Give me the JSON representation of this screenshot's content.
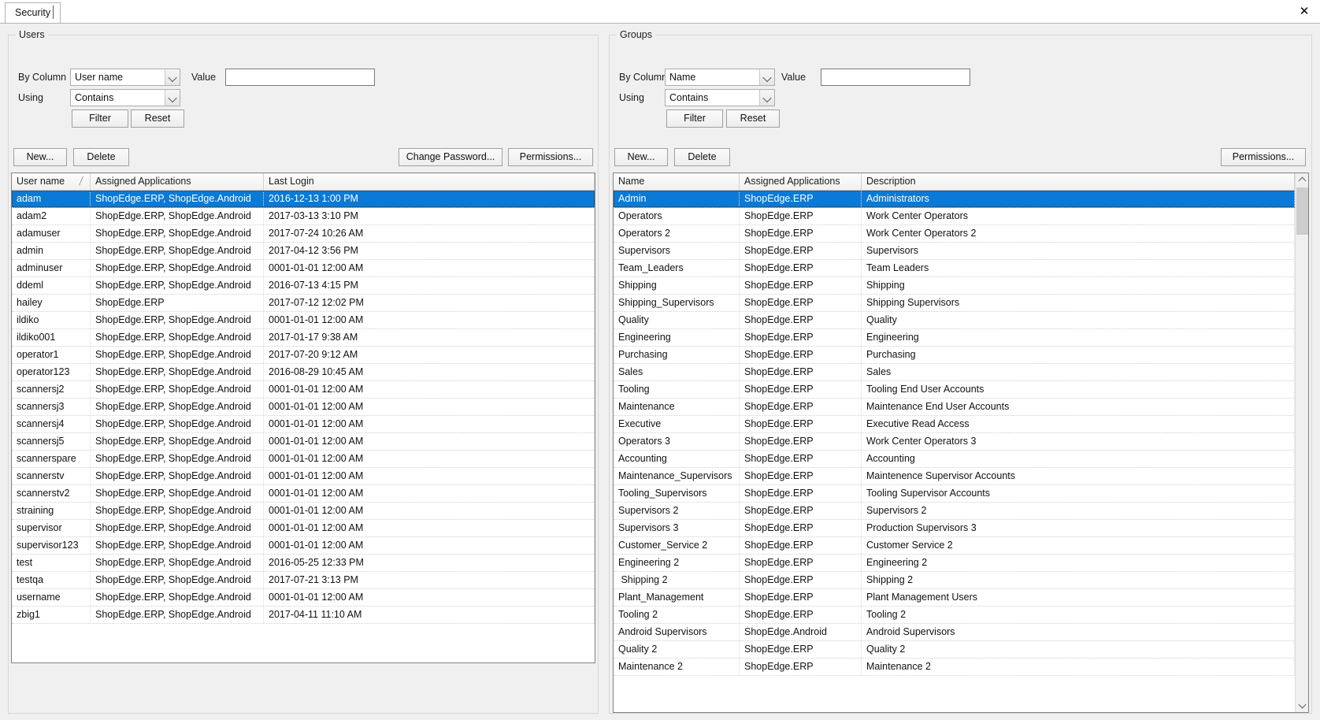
{
  "window": {
    "tab_label": "Security",
    "close_icon": "close-icon"
  },
  "users_panel": {
    "title": "Users",
    "filter": {
      "by_column_label": "By Column",
      "by_column_value": "User name",
      "using_label": "Using",
      "using_value": "Contains",
      "value_label": "Value",
      "value_text": "",
      "value_placeholder": "",
      "filter_button": "Filter",
      "reset_button": "Reset"
    },
    "toolbar": {
      "new_button": "New...",
      "delete_button": "Delete",
      "change_password_button": "Change Password...",
      "permissions_button": "Permissions..."
    },
    "columns": [
      "User name",
      "Assigned Applications",
      "Last Login"
    ],
    "sort_column": "User name",
    "sort_direction": "ascending",
    "selected_row_index": 0,
    "rows": [
      [
        "adam",
        "ShopEdge.ERP, ShopEdge.Android",
        "2016-12-13 1:00 PM"
      ],
      [
        "adam2",
        "ShopEdge.ERP, ShopEdge.Android",
        "2017-03-13 3:10 PM"
      ],
      [
        "adamuser",
        "ShopEdge.ERP, ShopEdge.Android",
        "2017-07-24 10:26 AM"
      ],
      [
        "admin",
        "ShopEdge.ERP, ShopEdge.Android",
        "2017-04-12 3:56 PM"
      ],
      [
        "adminuser",
        "ShopEdge.ERP, ShopEdge.Android",
        "0001-01-01 12:00 AM"
      ],
      [
        "ddeml",
        "ShopEdge.ERP, ShopEdge.Android",
        "2016-07-13 4:15 PM"
      ],
      [
        "hailey",
        "ShopEdge.ERP",
        "2017-07-12 12:02 PM"
      ],
      [
        "ildiko",
        "ShopEdge.ERP, ShopEdge.Android",
        "0001-01-01 12:00 AM"
      ],
      [
        "ildiko001",
        "ShopEdge.ERP, ShopEdge.Android",
        "2017-01-17 9:38 AM"
      ],
      [
        "operator1",
        "ShopEdge.ERP, ShopEdge.Android",
        "2017-07-20 9:12 AM"
      ],
      [
        "operator123",
        "ShopEdge.ERP, ShopEdge.Android",
        "2016-08-29 10:45 AM"
      ],
      [
        "scannersj2",
        "ShopEdge.ERP, ShopEdge.Android",
        "0001-01-01 12:00 AM"
      ],
      [
        "scannersj3",
        "ShopEdge.ERP, ShopEdge.Android",
        "0001-01-01 12:00 AM"
      ],
      [
        "scannersj4",
        "ShopEdge.ERP, ShopEdge.Android",
        "0001-01-01 12:00 AM"
      ],
      [
        "scannersj5",
        "ShopEdge.ERP, ShopEdge.Android",
        "0001-01-01 12:00 AM"
      ],
      [
        "scannerspare",
        "ShopEdge.ERP, ShopEdge.Android",
        "0001-01-01 12:00 AM"
      ],
      [
        "scannerstv",
        "ShopEdge.ERP, ShopEdge.Android",
        "0001-01-01 12:00 AM"
      ],
      [
        "scannerstv2",
        "ShopEdge.ERP, ShopEdge.Android",
        "0001-01-01 12:00 AM"
      ],
      [
        "straining",
        "ShopEdge.ERP, ShopEdge.Android",
        "0001-01-01 12:00 AM"
      ],
      [
        "supervisor",
        "ShopEdge.ERP, ShopEdge.Android",
        "0001-01-01 12:00 AM"
      ],
      [
        "supervisor123",
        "ShopEdge.ERP, ShopEdge.Android",
        "0001-01-01 12:00 AM"
      ],
      [
        "test",
        "ShopEdge.ERP, ShopEdge.Android",
        "2016-05-25 12:33 PM"
      ],
      [
        "testqa",
        "ShopEdge.ERP, ShopEdge.Android",
        "2017-07-21 3:13 PM"
      ],
      [
        "username",
        "ShopEdge.ERP, ShopEdge.Android",
        "0001-01-01 12:00 AM"
      ],
      [
        "zbig1",
        "ShopEdge.ERP, ShopEdge.Android",
        "2017-04-11 11:10 AM"
      ]
    ]
  },
  "groups_panel": {
    "title": "Groups",
    "filter": {
      "by_column_label": "By Column",
      "by_column_value": "Name",
      "using_label": "Using",
      "using_value": "Contains",
      "value_label": "Value",
      "value_text": "",
      "value_placeholder": "",
      "filter_button": "Filter",
      "reset_button": "Reset"
    },
    "toolbar": {
      "new_button": "New...",
      "delete_button": "Delete",
      "permissions_button": "Permissions..."
    },
    "columns": [
      "Name",
      "Assigned Applications",
      "Description"
    ],
    "selected_row_index": 0,
    "rows": [
      [
        "Admin",
        "ShopEdge.ERP",
        "Administrators"
      ],
      [
        "Operators",
        "ShopEdge.ERP",
        "Work Center Operators"
      ],
      [
        "Operators 2",
        "ShopEdge.ERP",
        "Work Center Operators 2"
      ],
      [
        "Supervisors",
        "ShopEdge.ERP",
        "Supervisors"
      ],
      [
        "Team_Leaders",
        "ShopEdge.ERP",
        "Team Leaders"
      ],
      [
        "Shipping",
        "ShopEdge.ERP",
        "Shipping"
      ],
      [
        "Shipping_Supervisors",
        "ShopEdge.ERP",
        "Shipping Supervisors"
      ],
      [
        "Quality",
        "ShopEdge.ERP",
        "Quality"
      ],
      [
        "Engineering",
        "ShopEdge.ERP",
        "Engineering"
      ],
      [
        "Purchasing",
        "ShopEdge.ERP",
        "Purchasing"
      ],
      [
        "Sales",
        "ShopEdge.ERP",
        "Sales"
      ],
      [
        "Tooling",
        "ShopEdge.ERP",
        "Tooling End User Accounts"
      ],
      [
        "Maintenance",
        "ShopEdge.ERP",
        "Maintenance End User Accounts"
      ],
      [
        "Executive",
        "ShopEdge.ERP",
        "Executive Read Access"
      ],
      [
        "Operators 3",
        "ShopEdge.ERP",
        "Work Center Operators 3"
      ],
      [
        "Accounting",
        "ShopEdge.ERP",
        "Accounting"
      ],
      [
        "Maintenance_Supervisors",
        "ShopEdge.ERP",
        "Maintenence Supervisor Accounts"
      ],
      [
        "Tooling_Supervisors",
        "ShopEdge.ERP",
        "Tooling Supervisor Accounts"
      ],
      [
        "Supervisors 2",
        "ShopEdge.ERP",
        "Supervisors 2"
      ],
      [
        "Supervisors 3",
        "ShopEdge.ERP",
        "Production Supervisors 3"
      ],
      [
        "Customer_Service 2",
        "ShopEdge.ERP",
        "Customer Service 2"
      ],
      [
        "Engineering 2",
        "ShopEdge.ERP",
        "Engineering 2"
      ],
      [
        " Shipping 2",
        "ShopEdge.ERP",
        "Shipping 2"
      ],
      [
        "Plant_Management",
        "ShopEdge.ERP",
        "Plant Management Users"
      ],
      [
        "Tooling 2",
        "ShopEdge.ERP",
        "Tooling 2"
      ],
      [
        "Android Supervisors",
        "ShopEdge.Android",
        "Android Supervisors"
      ],
      [
        "Quality 2",
        "ShopEdge.ERP",
        "Quality 2"
      ],
      [
        "Maintenance 2",
        "ShopEdge.ERP",
        "Maintenance 2"
      ]
    ],
    "scrollbar": {
      "up_icon": "chevron-up-icon",
      "down_icon": "chevron-down-icon"
    }
  },
  "colors": {
    "selection": "#0a7ad6",
    "panel_bg": "#f0f0f0",
    "grid_bg": "#ffffff"
  }
}
